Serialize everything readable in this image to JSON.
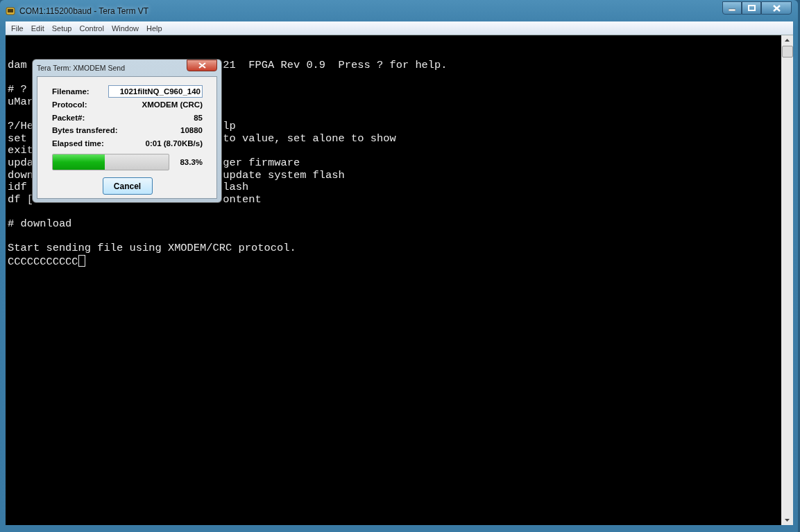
{
  "window": {
    "title": "COM1:115200baud - Tera Term VT"
  },
  "menu": [
    {
      "label": "File"
    },
    {
      "label": "Edit"
    },
    {
      "label": "Setup"
    },
    {
      "label": "Control"
    },
    {
      "label": "Window"
    },
    {
      "label": "Help"
    }
  ],
  "terminal": {
    "cursor_visible": true,
    "blocks": [
      {
        "lines": [
          {
            "text": "dam",
            "text_right": "21  FPGA Rev 0.9  Press ? for help."
          }
        ]
      },
      {
        "lines": [
          {
            "text": "# ?"
          },
          {
            "text": "uMar"
          }
        ]
      },
      {
        "lines": [
          {
            "text": "?/He",
            "text_right": "lp"
          },
          {
            "text": "set",
            "text_right": "to value, set alone to show"
          },
          {
            "text": "exit"
          },
          {
            "text": "upda",
            "text_right": "ger firmware"
          },
          {
            "text": "down",
            "text_right": "update system flash"
          },
          {
            "text": "idf",
            "text_right": "lash"
          },
          {
            "text": "df [",
            "text_right": "ontent"
          }
        ]
      },
      {
        "lines": [
          {
            "text": "# download"
          }
        ]
      },
      {
        "lines": [
          {
            "text": "Start sending file using XMODEM/CRC protocol."
          },
          {
            "text": "CCCCCCCCCCC"
          }
        ]
      }
    ]
  },
  "dialog": {
    "title": "Tera Term: XMODEM Send",
    "fields": [
      {
        "label": "Filename:",
        "value": "1021filtNQ_C960_140",
        "kind": "input"
      },
      {
        "label": "Protocol:",
        "value": "XMODEM (CRC)",
        "kind": "text"
      },
      {
        "label": "Packet#:",
        "value": "85",
        "kind": "text"
      },
      {
        "label": "Bytes transfered:",
        "value": "10880",
        "kind": "text"
      },
      {
        "label": "Elapsed time:",
        "value": "0:01 (8.70KB/s)",
        "kind": "text"
      }
    ],
    "progress": {
      "level": 0.45,
      "reading": "83.3%"
    },
    "button": "Cancel"
  }
}
